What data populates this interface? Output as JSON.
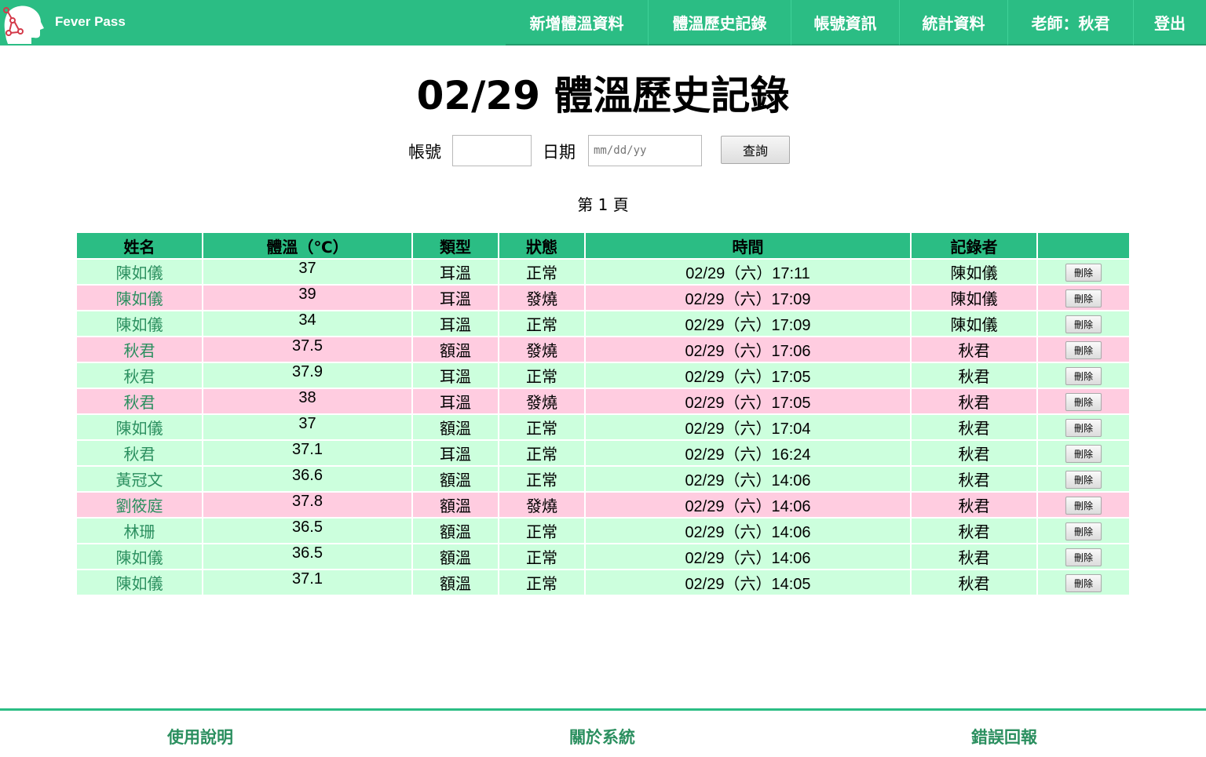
{
  "brand": {
    "name": "Fever Pass"
  },
  "nav": {
    "items": [
      "新增體溫資料",
      "體溫歷史記錄",
      "帳號資訊",
      "統計資料",
      "老師：秋君",
      "登出"
    ]
  },
  "page": {
    "title": "02/29 體溫歷史記錄"
  },
  "search": {
    "account_label": "帳號",
    "account_value": "",
    "date_label": "日期",
    "date_placeholder": "mm/dd/yy",
    "query_button": "查詢"
  },
  "pagination": {
    "label": "第 1 頁"
  },
  "table": {
    "headers": [
      "姓名",
      "體溫（℃）",
      "類型",
      "狀態",
      "時間",
      "記錄者",
      ""
    ],
    "delete_label": "刪除",
    "rows": [
      {
        "name": "陳如儀",
        "temp": "37",
        "type": "耳溫",
        "status": "正常",
        "time": "02/29（六）17:11",
        "recorder": "陳如儀",
        "fever": false
      },
      {
        "name": "陳如儀",
        "temp": "39",
        "type": "耳溫",
        "status": "發燒",
        "time": "02/29（六）17:09",
        "recorder": "陳如儀",
        "fever": true
      },
      {
        "name": "陳如儀",
        "temp": "34",
        "type": "耳溫",
        "status": "正常",
        "time": "02/29（六）17:09",
        "recorder": "陳如儀",
        "fever": false
      },
      {
        "name": "秋君",
        "temp": "37.5",
        "type": "額溫",
        "status": "發燒",
        "time": "02/29（六）17:06",
        "recorder": "秋君",
        "fever": true
      },
      {
        "name": "秋君",
        "temp": "37.9",
        "type": "耳溫",
        "status": "正常",
        "time": "02/29（六）17:05",
        "recorder": "秋君",
        "fever": false
      },
      {
        "name": "秋君",
        "temp": "38",
        "type": "耳溫",
        "status": "發燒",
        "time": "02/29（六）17:05",
        "recorder": "秋君",
        "fever": true
      },
      {
        "name": "陳如儀",
        "temp": "37",
        "type": "額溫",
        "status": "正常",
        "time": "02/29（六）17:04",
        "recorder": "秋君",
        "fever": false
      },
      {
        "name": "秋君",
        "temp": "37.1",
        "type": "耳溫",
        "status": "正常",
        "time": "02/29（六）16:24",
        "recorder": "秋君",
        "fever": false
      },
      {
        "name": "黃冠文",
        "temp": "36.6",
        "type": "額溫",
        "status": "正常",
        "time": "02/29（六）14:06",
        "recorder": "秋君",
        "fever": false
      },
      {
        "name": "劉筱庭",
        "temp": "37.8",
        "type": "額溫",
        "status": "發燒",
        "time": "02/29（六）14:06",
        "recorder": "秋君",
        "fever": true
      },
      {
        "name": "林珊",
        "temp": "36.5",
        "type": "額溫",
        "status": "正常",
        "time": "02/29（六）14:06",
        "recorder": "秋君",
        "fever": false
      },
      {
        "name": "陳如儀",
        "temp": "36.5",
        "type": "額溫",
        "status": "正常",
        "time": "02/29（六）14:06",
        "recorder": "秋君",
        "fever": false
      },
      {
        "name": "陳如儀",
        "temp": "37.1",
        "type": "額溫",
        "status": "正常",
        "time": "02/29（六）14:05",
        "recorder": "秋君",
        "fever": false
      }
    ]
  },
  "footer": {
    "links": [
      "使用說明",
      "關於系統",
      "錯誤回報"
    ]
  },
  "colors": {
    "brand_green": "#2bbd84",
    "row_normal": "#ccffdd",
    "row_fever": "#ffcce0",
    "link_green": "#2b8f5f"
  },
  "icons": {
    "logo": "head-virus-logo-icon"
  }
}
